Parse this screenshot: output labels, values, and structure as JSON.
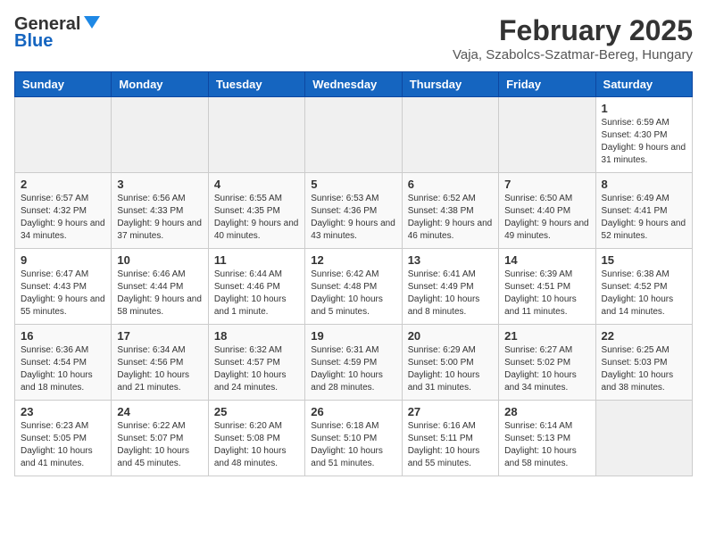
{
  "header": {
    "logo_line1": "General",
    "logo_line2": "Blue",
    "title": "February 2025",
    "subtitle": "Vaja, Szabolcs-Szatmar-Bereg, Hungary"
  },
  "weekdays": [
    "Sunday",
    "Monday",
    "Tuesday",
    "Wednesday",
    "Thursday",
    "Friday",
    "Saturday"
  ],
  "weeks": [
    [
      {
        "day": "",
        "info": ""
      },
      {
        "day": "",
        "info": ""
      },
      {
        "day": "",
        "info": ""
      },
      {
        "day": "",
        "info": ""
      },
      {
        "day": "",
        "info": ""
      },
      {
        "day": "",
        "info": ""
      },
      {
        "day": "1",
        "info": "Sunrise: 6:59 AM\nSunset: 4:30 PM\nDaylight: 9 hours and 31 minutes."
      }
    ],
    [
      {
        "day": "2",
        "info": "Sunrise: 6:57 AM\nSunset: 4:32 PM\nDaylight: 9 hours and 34 minutes."
      },
      {
        "day": "3",
        "info": "Sunrise: 6:56 AM\nSunset: 4:33 PM\nDaylight: 9 hours and 37 minutes."
      },
      {
        "day": "4",
        "info": "Sunrise: 6:55 AM\nSunset: 4:35 PM\nDaylight: 9 hours and 40 minutes."
      },
      {
        "day": "5",
        "info": "Sunrise: 6:53 AM\nSunset: 4:36 PM\nDaylight: 9 hours and 43 minutes."
      },
      {
        "day": "6",
        "info": "Sunrise: 6:52 AM\nSunset: 4:38 PM\nDaylight: 9 hours and 46 minutes."
      },
      {
        "day": "7",
        "info": "Sunrise: 6:50 AM\nSunset: 4:40 PM\nDaylight: 9 hours and 49 minutes."
      },
      {
        "day": "8",
        "info": "Sunrise: 6:49 AM\nSunset: 4:41 PM\nDaylight: 9 hours and 52 minutes."
      }
    ],
    [
      {
        "day": "9",
        "info": "Sunrise: 6:47 AM\nSunset: 4:43 PM\nDaylight: 9 hours and 55 minutes."
      },
      {
        "day": "10",
        "info": "Sunrise: 6:46 AM\nSunset: 4:44 PM\nDaylight: 9 hours and 58 minutes."
      },
      {
        "day": "11",
        "info": "Sunrise: 6:44 AM\nSunset: 4:46 PM\nDaylight: 10 hours and 1 minute."
      },
      {
        "day": "12",
        "info": "Sunrise: 6:42 AM\nSunset: 4:48 PM\nDaylight: 10 hours and 5 minutes."
      },
      {
        "day": "13",
        "info": "Sunrise: 6:41 AM\nSunset: 4:49 PM\nDaylight: 10 hours and 8 minutes."
      },
      {
        "day": "14",
        "info": "Sunrise: 6:39 AM\nSunset: 4:51 PM\nDaylight: 10 hours and 11 minutes."
      },
      {
        "day": "15",
        "info": "Sunrise: 6:38 AM\nSunset: 4:52 PM\nDaylight: 10 hours and 14 minutes."
      }
    ],
    [
      {
        "day": "16",
        "info": "Sunrise: 6:36 AM\nSunset: 4:54 PM\nDaylight: 10 hours and 18 minutes."
      },
      {
        "day": "17",
        "info": "Sunrise: 6:34 AM\nSunset: 4:56 PM\nDaylight: 10 hours and 21 minutes."
      },
      {
        "day": "18",
        "info": "Sunrise: 6:32 AM\nSunset: 4:57 PM\nDaylight: 10 hours and 24 minutes."
      },
      {
        "day": "19",
        "info": "Sunrise: 6:31 AM\nSunset: 4:59 PM\nDaylight: 10 hours and 28 minutes."
      },
      {
        "day": "20",
        "info": "Sunrise: 6:29 AM\nSunset: 5:00 PM\nDaylight: 10 hours and 31 minutes."
      },
      {
        "day": "21",
        "info": "Sunrise: 6:27 AM\nSunset: 5:02 PM\nDaylight: 10 hours and 34 minutes."
      },
      {
        "day": "22",
        "info": "Sunrise: 6:25 AM\nSunset: 5:03 PM\nDaylight: 10 hours and 38 minutes."
      }
    ],
    [
      {
        "day": "23",
        "info": "Sunrise: 6:23 AM\nSunset: 5:05 PM\nDaylight: 10 hours and 41 minutes."
      },
      {
        "day": "24",
        "info": "Sunrise: 6:22 AM\nSunset: 5:07 PM\nDaylight: 10 hours and 45 minutes."
      },
      {
        "day": "25",
        "info": "Sunrise: 6:20 AM\nSunset: 5:08 PM\nDaylight: 10 hours and 48 minutes."
      },
      {
        "day": "26",
        "info": "Sunrise: 6:18 AM\nSunset: 5:10 PM\nDaylight: 10 hours and 51 minutes."
      },
      {
        "day": "27",
        "info": "Sunrise: 6:16 AM\nSunset: 5:11 PM\nDaylight: 10 hours and 55 minutes."
      },
      {
        "day": "28",
        "info": "Sunrise: 6:14 AM\nSunset: 5:13 PM\nDaylight: 10 hours and 58 minutes."
      },
      {
        "day": "",
        "info": ""
      }
    ]
  ]
}
